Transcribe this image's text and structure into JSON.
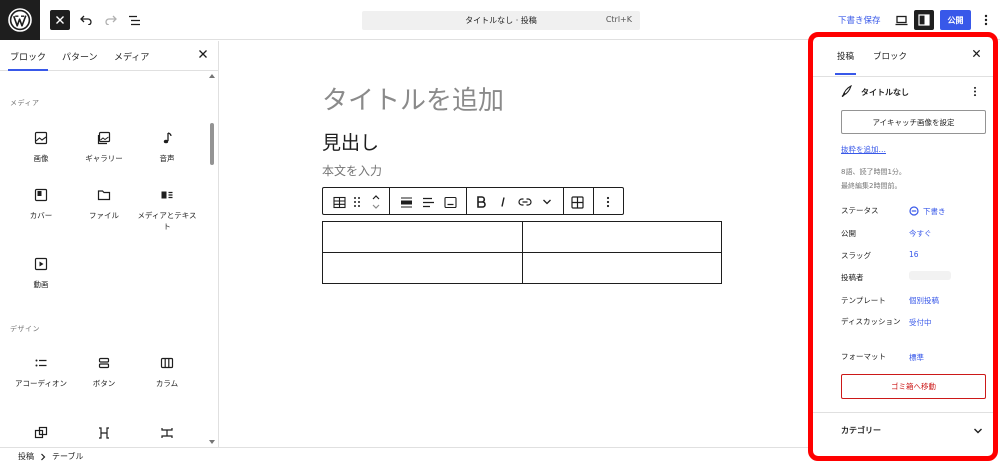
{
  "topbar": {
    "command_title": "タイトルなし · 投稿",
    "command_shortcut": "Ctrl+K",
    "save_draft_label": "下書き保存",
    "publish_label": "公開"
  },
  "inserter": {
    "tabs": [
      "ブロック",
      "パターン",
      "メディア"
    ],
    "sections": {
      "media": "メディア",
      "design": "デザイン"
    },
    "media_blocks": [
      "画像",
      "ギャラリー",
      "音声",
      "カバー",
      "ファイル",
      "メディアとテキスト",
      "動画"
    ],
    "design_blocks": [
      "アコーディオン",
      "ボタン",
      "カラム"
    ]
  },
  "canvas": {
    "title_placeholder": "タイトルを追加",
    "heading": "見出し",
    "paragraph_placeholder": "本文を入力"
  },
  "breadcrumb": [
    "投稿",
    "テーブル"
  ],
  "sidebar": {
    "tabs": [
      "投稿",
      "ブロック"
    ],
    "post_name": "タイトルなし",
    "featured_image_label": "アイキャッチ画像を設定",
    "excerpt_link": "抜粋を追加…",
    "meta_words": "8語、読了時間1分。",
    "meta_edited": "最終編集2時間前。",
    "rows": [
      {
        "label": "ステータス",
        "value": "下書き"
      },
      {
        "label": "公開",
        "value": "今すぐ"
      },
      {
        "label": "スラッグ",
        "value": "16"
      },
      {
        "label": "投稿者",
        "value": ""
      },
      {
        "label": "テンプレート",
        "value": "個別投稿"
      },
      {
        "label": "ディスカッション",
        "value": "受付中"
      },
      {
        "label": "フォーマット",
        "value": "標準"
      }
    ],
    "trash_label": "ゴミ箱へ移動",
    "category_label": "カテゴリー"
  },
  "colors": {
    "accent": "#3858e9",
    "highlight": "#ff0000",
    "danger": "#cc1818"
  }
}
